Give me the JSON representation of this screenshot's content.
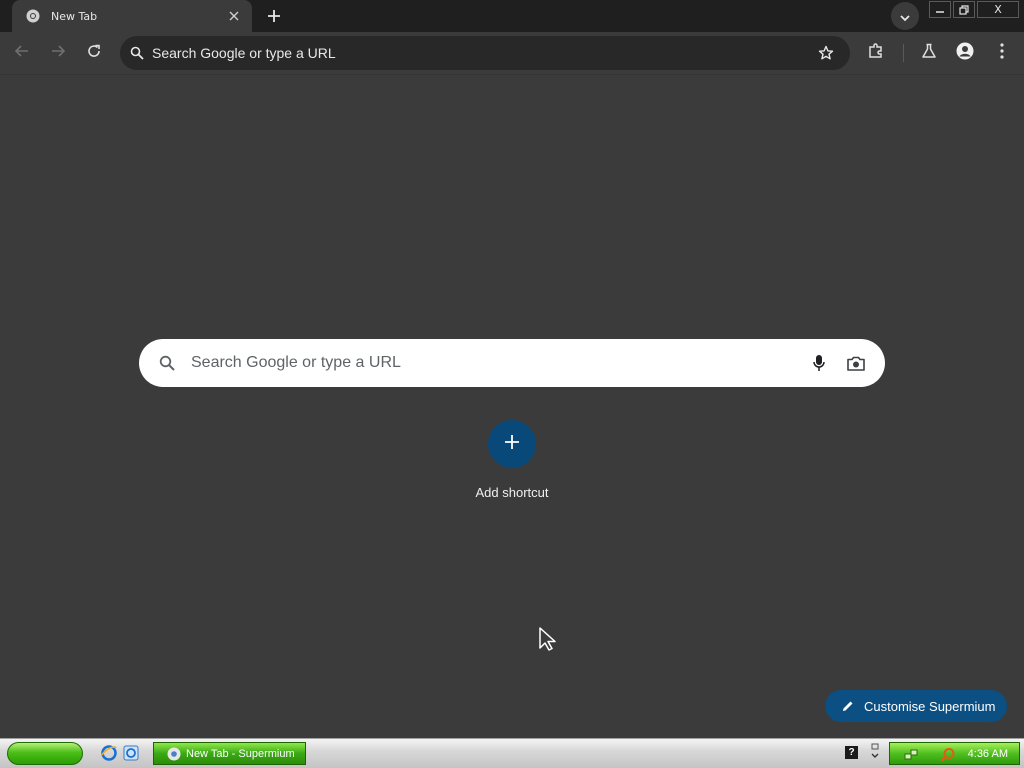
{
  "browser": {
    "tab": {
      "title": "New Tab",
      "favicon": "chrome-icon",
      "close_icon": "close-icon"
    },
    "window_controls": {
      "minimize": "—",
      "restore": "⧉",
      "close": "X"
    },
    "omnibox": {
      "placeholder": "Search Google or type a URL"
    }
  },
  "ntp": {
    "search_placeholder": "Search Google or type a URL",
    "add_shortcut_label": "Add shortcut",
    "customise_label": "Customise Supermium"
  },
  "taskbar": {
    "task_button_label": "New Tab - Supermium",
    "help_label": "?",
    "clock": "4:36 AM"
  },
  "colors": {
    "page_bg": "#3b3b3b",
    "tabstrip_bg": "#1f1f1f",
    "accent_blue": "#08497a",
    "xp_green": "#3aa914"
  }
}
